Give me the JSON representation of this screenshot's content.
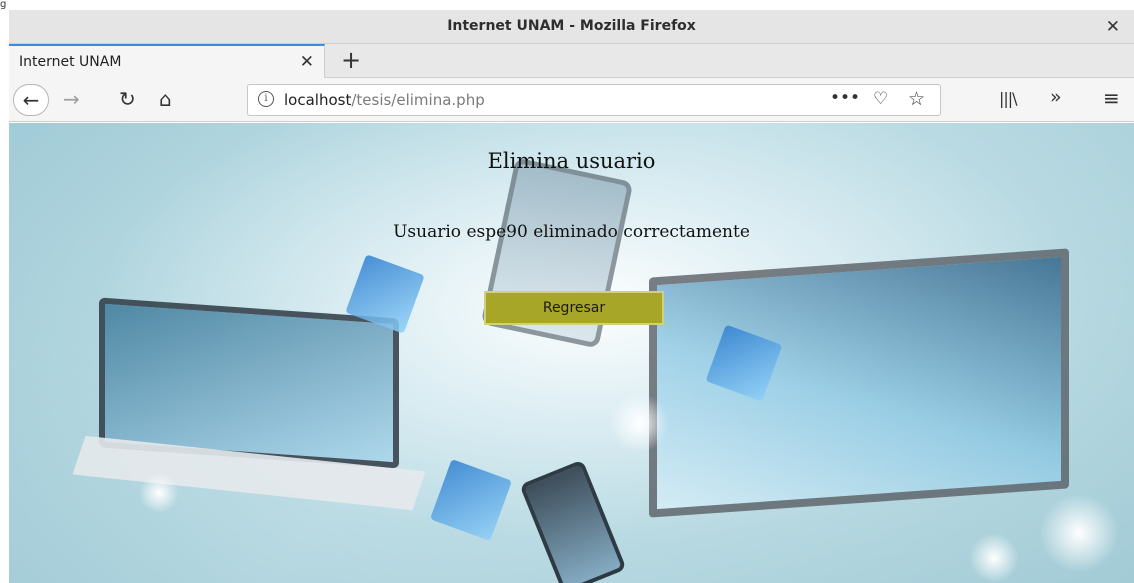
{
  "window": {
    "title": "Internet UNAM - Mozilla Firefox"
  },
  "tabs": [
    {
      "label": "Internet UNAM",
      "active": true
    }
  ],
  "toolbar": {
    "new_tab_symbol": "+",
    "url_host": "localhost",
    "url_path": "/tesis/elimina.php",
    "page_actions_symbol": "•••"
  },
  "page": {
    "heading": "Elimina usuario",
    "message": "Usuario espe90 eliminado correctamente",
    "back_button_label": "Regresar"
  },
  "colors": {
    "button_bg": "#a8a628",
    "tab_accent": "#3a8ce0"
  },
  "icons": {
    "back": "arrow-left",
    "forward": "arrow-right",
    "reload": "reload",
    "home": "home",
    "info": "info",
    "pocket": "pocket",
    "bookmark": "star",
    "library": "library",
    "overflow": "chevron-double-right",
    "menu": "hamburger"
  }
}
